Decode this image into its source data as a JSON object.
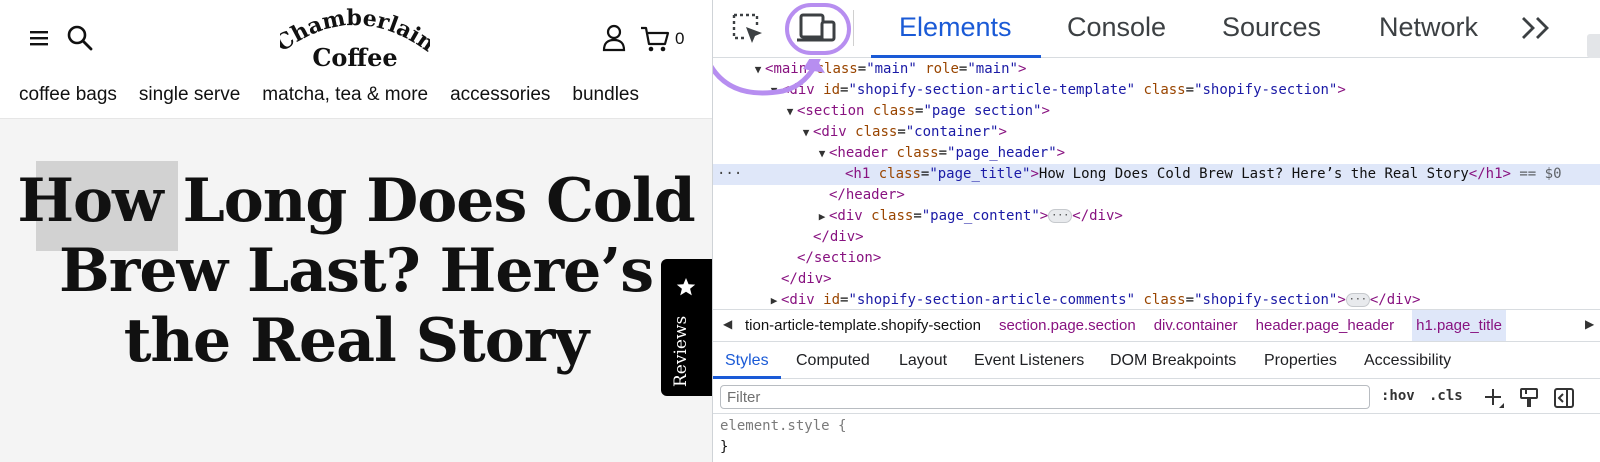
{
  "site": {
    "logo": {
      "line1": "Chamberlain",
      "line2": "Coffee"
    },
    "cart_count": "0",
    "nav": [
      "coffee bags",
      "single serve",
      "matcha, tea & more",
      "accessories",
      "bundles"
    ],
    "title_lines": [
      "How Long Does Cold",
      "Brew Last? Here’s",
      "the Real Story"
    ],
    "reviews_label": "Reviews",
    "icons": [
      "hamburger-icon",
      "search-icon",
      "account-icon",
      "cart-icon",
      "star-icon"
    ]
  },
  "devtools": {
    "tabs": [
      "Elements",
      "Console",
      "Sources",
      "Network"
    ],
    "active_tab": "Elements",
    "highlight_color": "#b78ef0",
    "dom": [
      {
        "parts": [
          [
            "tg",
            "<"
          ],
          [
            "tg",
            "main"
          ],
          [
            "tx",
            " "
          ],
          [
            "an",
            "class"
          ],
          [
            "tx",
            "="
          ],
          [
            "av",
            "\"main\""
          ],
          [
            "tx",
            " "
          ],
          [
            "an",
            "role"
          ],
          [
            "tx",
            "="
          ],
          [
            "av",
            "\"main\""
          ],
          [
            "tg",
            ">"
          ]
        ]
      },
      {
        "parts": [
          [
            "tg",
            "<div"
          ],
          [
            "tx",
            " "
          ],
          [
            "an",
            "id"
          ],
          [
            "tx",
            "="
          ],
          [
            "av",
            "\"shopify-section-article-template\""
          ],
          [
            "tx",
            " "
          ],
          [
            "an",
            "class"
          ],
          [
            "tx",
            "="
          ],
          [
            "av",
            "\"shopify-section\""
          ],
          [
            "tg",
            ">"
          ]
        ]
      },
      {
        "parts": [
          [
            "tg",
            "<section"
          ],
          [
            "tx",
            " "
          ],
          [
            "an",
            "class"
          ],
          [
            "tx",
            "="
          ],
          [
            "av",
            "\"page section\""
          ],
          [
            "tg",
            ">"
          ]
        ]
      },
      {
        "parts": [
          [
            "tg",
            "<div"
          ],
          [
            "tx",
            " "
          ],
          [
            "an",
            "class"
          ],
          [
            "tx",
            "="
          ],
          [
            "av",
            "\"container\""
          ],
          [
            "tg",
            ">"
          ]
        ]
      },
      {
        "parts": [
          [
            "tg",
            "<header"
          ],
          [
            "tx",
            " "
          ],
          [
            "an",
            "class"
          ],
          [
            "tx",
            "="
          ],
          [
            "av",
            "\"page_header\""
          ],
          [
            "tg",
            ">"
          ]
        ]
      },
      {
        "parts": [
          [
            "tg",
            "<h1"
          ],
          [
            "tx",
            " "
          ],
          [
            "an",
            "class"
          ],
          [
            "tx",
            "="
          ],
          [
            "av",
            "\"page_title\""
          ],
          [
            "tg",
            ">"
          ],
          [
            "tx",
            "How Long Does Cold Brew Last? Here’s the Real Story"
          ],
          [
            "tg",
            "</h1>"
          ],
          [
            "dim",
            " == $0"
          ]
        ]
      },
      {
        "parts": [
          [
            "tg",
            "</header>"
          ]
        ]
      },
      {
        "parts": [
          [
            "tg",
            "<div"
          ],
          [
            "tx",
            " "
          ],
          [
            "an",
            "class"
          ],
          [
            "tx",
            "="
          ],
          [
            "av",
            "\"page_content\""
          ],
          [
            "tg",
            ">"
          ],
          [
            "pill",
            "···"
          ],
          [
            "tg",
            "</div>"
          ]
        ]
      },
      {
        "parts": [
          [
            "tg",
            "</div>"
          ]
        ]
      },
      {
        "parts": [
          [
            "tg",
            "</section>"
          ]
        ]
      },
      {
        "parts": [
          [
            "tg",
            "</div>"
          ]
        ]
      },
      {
        "parts": [
          [
            "tg",
            "<div"
          ],
          [
            "tx",
            " "
          ],
          [
            "an",
            "id"
          ],
          [
            "tx",
            "="
          ],
          [
            "av",
            "\"shopify-section-article-comments\""
          ],
          [
            "tx",
            " "
          ],
          [
            "an",
            "class"
          ],
          [
            "tx",
            "="
          ],
          [
            "av",
            "\"shopify-section\""
          ],
          [
            "tg",
            ">"
          ],
          [
            "pill",
            "···"
          ],
          [
            "tg",
            "</div>"
          ]
        ]
      }
    ],
    "breadcrumbs": [
      "tion-article-template.shopify-section",
      "section.page.section",
      "div.container",
      "header.page_header",
      "h1.page_title"
    ],
    "subtabs": [
      "Styles",
      "Computed",
      "Layout",
      "Event Listeners",
      "DOM Breakpoints",
      "Properties",
      "Accessibility"
    ],
    "filter_placeholder": "Filter",
    "hov": ":hov",
    "cls": ".cls",
    "element_style": "element.style {",
    "close_brace": "}"
  }
}
